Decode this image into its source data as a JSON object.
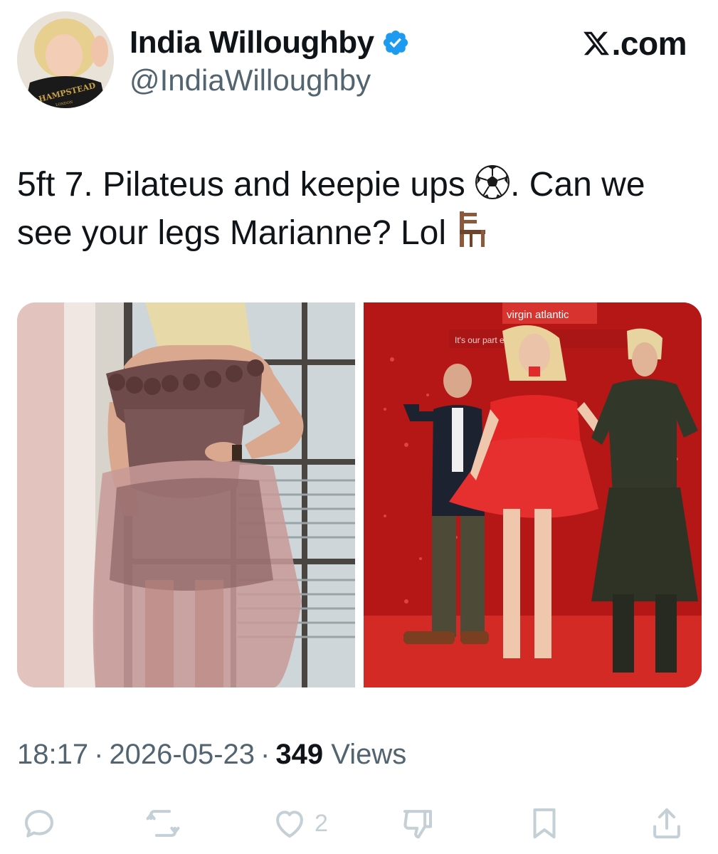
{
  "header": {
    "display_name": "India Willoughby",
    "handle": "@IndiaWilloughby",
    "verified": true,
    "brand": ".com",
    "brand_icon": "x-logo-icon"
  },
  "avatar": {
    "shirt_text": "HAMPSTEAD",
    "shirt_subtext": "LONDON"
  },
  "tweet": {
    "text_part1": "5ft 7. Pilateus and keepie ups ",
    "emoji1": "soccer-ball-icon",
    "text_part2": ". Can we see your legs Marianne? Lol ",
    "emoji2": "chair-icon"
  },
  "media": {
    "left_image": "woman-in-pink-tulle-dress-by-window",
    "right_image": "people-dancing-on-red-stage",
    "right_sign": "virgin atlantic",
    "right_banner": "It's our part    e fly how we wa"
  },
  "meta": {
    "time": "18:17",
    "date": "2026-05-23",
    "views_count": "349",
    "views_label": "Views"
  },
  "actions": {
    "like_count": "2"
  },
  "colors": {
    "text_primary": "#0f1419",
    "text_secondary": "#536471",
    "icon_muted": "#c4cfd6",
    "verified_blue": "#1d9bf0"
  }
}
